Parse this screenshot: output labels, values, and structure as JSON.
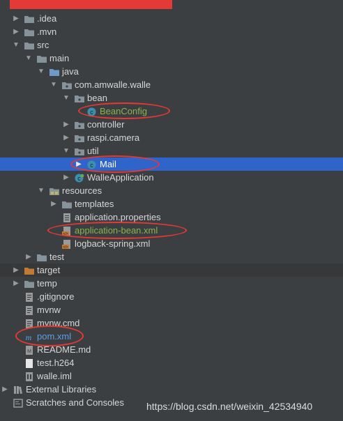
{
  "project_tree": {
    "items": [
      {
        "label": ".idea",
        "depth": 1,
        "expander": "collapsed",
        "icon": "folder-icon",
        "color": "#d6d6d6"
      },
      {
        "label": ".mvn",
        "depth": 1,
        "expander": "collapsed",
        "icon": "folder-icon",
        "color": "#d6d6d6"
      },
      {
        "label": "src",
        "depth": 1,
        "expander": "expanded",
        "icon": "folder-icon",
        "color": "#d6d6d6"
      },
      {
        "label": "main",
        "depth": 2,
        "expander": "expanded",
        "icon": "folder-icon",
        "color": "#d6d6d6"
      },
      {
        "label": "java",
        "depth": 3,
        "expander": "expanded",
        "icon": "source-folder-icon",
        "color": "#d6d6d6"
      },
      {
        "label": "com.amwalle.walle",
        "depth": 4,
        "expander": "expanded",
        "icon": "package-icon",
        "color": "#d6d6d6"
      },
      {
        "label": "bean",
        "depth": 5,
        "expander": "expanded",
        "icon": "package-icon",
        "color": "#d6d6d6"
      },
      {
        "label": "BeanConfig",
        "depth": 6,
        "expander": "none",
        "icon": "class-icon",
        "color": "#8cb24c"
      },
      {
        "label": "controller",
        "depth": 5,
        "expander": "collapsed",
        "icon": "package-icon",
        "color": "#d6d6d6"
      },
      {
        "label": "raspi.camera",
        "depth": 5,
        "expander": "collapsed",
        "icon": "package-icon",
        "color": "#d6d6d6"
      },
      {
        "label": "util",
        "depth": 5,
        "expander": "expanded",
        "icon": "package-icon",
        "color": "#d6d6d6"
      },
      {
        "label": "Mail",
        "depth": 6,
        "expander": "collapsed",
        "icon": "class-icon",
        "color": "#ffffff",
        "selected": true
      },
      {
        "label": "WalleApplication",
        "depth": 5,
        "expander": "collapsed",
        "icon": "spring-class-icon",
        "color": "#d6d6d6"
      },
      {
        "label": "resources",
        "depth": 3,
        "expander": "expanded",
        "icon": "resources-folder-icon",
        "color": "#d6d6d6"
      },
      {
        "label": "templates",
        "depth": 4,
        "expander": "collapsed",
        "icon": "folder-icon",
        "color": "#d6d6d6"
      },
      {
        "label": "application.properties",
        "depth": 4,
        "expander": "none",
        "icon": "properties-file-icon",
        "color": "#d6d6d6"
      },
      {
        "label": "application-bean.xml",
        "depth": 4,
        "expander": "none",
        "icon": "xml-file-icon",
        "color": "#8cb24c"
      },
      {
        "label": "logback-spring.xml",
        "depth": 4,
        "expander": "none",
        "icon": "xml-file-icon",
        "color": "#d6d6d6"
      },
      {
        "label": "test",
        "depth": 2,
        "expander": "collapsed",
        "icon": "folder-icon",
        "color": "#d6d6d6"
      },
      {
        "label": "target",
        "depth": 1,
        "expander": "collapsed",
        "icon": "excluded-folder-icon",
        "color": "#d6d6d6",
        "dark": true
      },
      {
        "label": "temp",
        "depth": 1,
        "expander": "collapsed",
        "icon": "folder-icon",
        "color": "#d6d6d6"
      },
      {
        "label": ".gitignore",
        "depth": 1,
        "expander": "none",
        "icon": "text-file-icon",
        "color": "#d6d6d6"
      },
      {
        "label": "mvnw",
        "depth": 1,
        "expander": "none",
        "icon": "text-file-icon",
        "color": "#d6d6d6"
      },
      {
        "label": "mvnw.cmd",
        "depth": 1,
        "expander": "none",
        "icon": "text-file-icon",
        "color": "#d6d6d6"
      },
      {
        "label": "pom.xml",
        "depth": 1,
        "expander": "none",
        "icon": "maven-icon",
        "color": "#5d9ee8"
      },
      {
        "label": "README.md",
        "depth": 1,
        "expander": "none",
        "icon": "markdown-file-icon",
        "color": "#d6d6d6"
      },
      {
        "label": "test.h264",
        "depth": 1,
        "expander": "none",
        "icon": "generic-file-icon",
        "color": "#d6d6d6"
      },
      {
        "label": "walle.iml",
        "depth": 1,
        "expander": "none",
        "icon": "module-file-icon",
        "color": "#d6d6d6"
      },
      {
        "label": "External Libraries",
        "depth": 0,
        "expander": "collapsed",
        "icon": "libraries-icon",
        "color": "#d6d6d6"
      },
      {
        "label": "Scratches and Consoles",
        "depth": 0,
        "expander": "none",
        "icon": "scratches-icon",
        "color": "#d6d6d6"
      }
    ]
  },
  "watermark": "https://blog.csdn.net/weixin_42534940",
  "colors": {
    "background": "#3c3f41",
    "selection": "#2f65ca",
    "annotation": "#e53935",
    "modified_green": "#8cb24c",
    "maven_blue": "#5d9ee8",
    "folder": "#87939a",
    "excluded_folder": "#c27a32",
    "source_folder": "#6d9ac7"
  }
}
